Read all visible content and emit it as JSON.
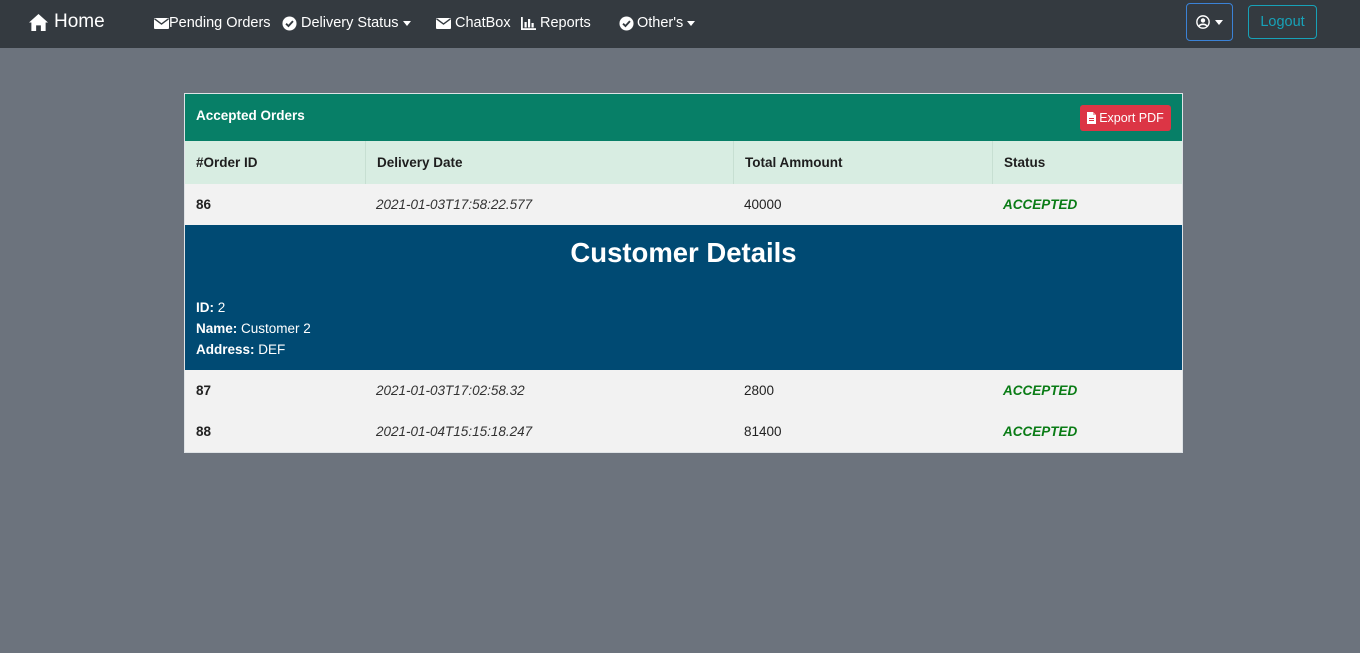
{
  "nav": {
    "brand": "Home",
    "pending_orders": "Pending Orders",
    "delivery_status": "Delivery Status",
    "chatbox": "ChatBox",
    "reports": "Reports",
    "others": "Other's",
    "logout": "Logout"
  },
  "card": {
    "title": "Accepted Orders",
    "export_label": "Export PDF",
    "columns": [
      "#Order ID",
      "Delivery Date",
      "Total Ammount",
      "Status"
    ],
    "rows": [
      {
        "id": "86",
        "date": "2021-01-03T17:58:22.577",
        "amount": "40000",
        "status": "ACCEPTED"
      },
      {
        "id": "87",
        "date": "2021-01-03T17:02:58.32",
        "amount": "2800",
        "status": "ACCEPTED"
      },
      {
        "id": "88",
        "date": "2021-01-04T15:15:18.247",
        "amount": "81400",
        "status": "ACCEPTED"
      }
    ],
    "details": {
      "title": "Customer Details",
      "id_label": "ID:",
      "id_value": "2",
      "name_label": "Name:",
      "name_value": "Customer 2",
      "address_label": "Address:",
      "address_value": "DEF"
    }
  },
  "colors": {
    "navbar": "#343a40",
    "header": "#077f67",
    "details": "#004a73",
    "status": "#0a7c16",
    "export": "#dc3545"
  }
}
